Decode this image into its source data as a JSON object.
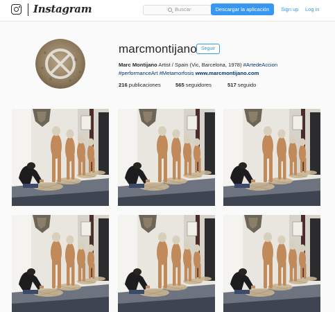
{
  "topbar": {
    "brand": "Instagram",
    "search_placeholder": "Buscar",
    "download_button": "Descargar la aplicación",
    "signup_link": "Sign up",
    "login_link": "Log in"
  },
  "profile": {
    "username": "marcmontijano",
    "follow_button": "Seguir",
    "bio_name": "Marc Montijano",
    "bio_text": " Artist / Spain (Vic, Barcelona, 1978) ",
    "bio_tag_1": "#ArtedeAccion",
    "bio_tag_2": "#performanceArt",
    "bio_tag_3": "#Metamorfosis",
    "bio_url": "www.marcmontijano.com",
    "posts_count": "216",
    "posts_label": " publicaciones",
    "followers_count": "565",
    "followers_label": " seguidores",
    "following_count": "517",
    "following_label": " seguido"
  },
  "colors": {
    "accent": "#3897f0",
    "link_dark": "#003569",
    "text": "#262626"
  },
  "icons": {
    "logo": "instagram-camera-icon",
    "search": "search-icon"
  }
}
